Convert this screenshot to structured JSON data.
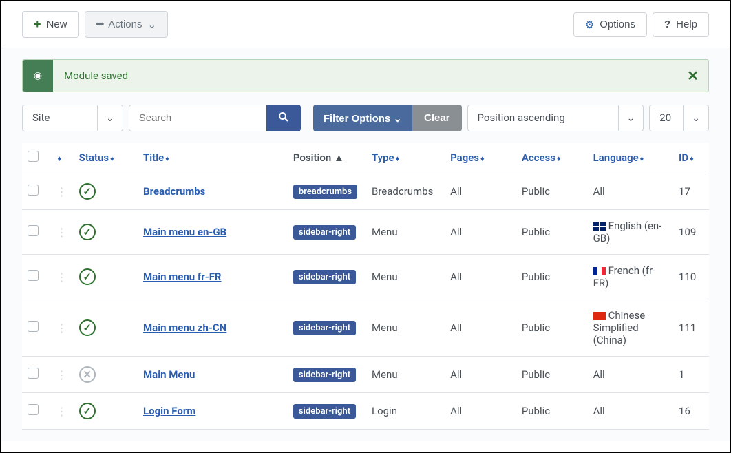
{
  "toolbar": {
    "new_label": "New",
    "actions_label": "Actions",
    "options_label": "Options",
    "help_label": "Help"
  },
  "alert": {
    "message": "Module saved"
  },
  "filters": {
    "site_label": "Site",
    "search_placeholder": "Search",
    "filter_options_label": "Filter Options",
    "clear_label": "Clear",
    "sort_label": "Position ascending",
    "limit_label": "20"
  },
  "columns": {
    "status": "Status",
    "title": "Title",
    "position": "Position",
    "type": "Type",
    "pages": "Pages",
    "access": "Access",
    "language": "Language",
    "id": "ID"
  },
  "rows": [
    {
      "status": "published",
      "title": "Breadcrumbs",
      "position": "breadcrumbs",
      "type": "Breadcrumbs",
      "pages": "All",
      "access": "Public",
      "language": "All",
      "flag": "",
      "id": "17"
    },
    {
      "status": "published",
      "title": "Main menu en-GB",
      "position": "sidebar-right",
      "type": "Menu",
      "pages": "All",
      "access": "Public",
      "language": "English (en-GB)",
      "flag": "gb",
      "id": "109"
    },
    {
      "status": "published",
      "title": "Main menu fr-FR",
      "position": "sidebar-right",
      "type": "Menu",
      "pages": "All",
      "access": "Public",
      "language": "French (fr-FR)",
      "flag": "fr",
      "id": "110"
    },
    {
      "status": "published",
      "title": "Main menu zh-CN",
      "position": "sidebar-right",
      "type": "Menu",
      "pages": "All",
      "access": "Public",
      "language": "Chinese Simplified (China)",
      "flag": "cn",
      "id": "111"
    },
    {
      "status": "unpublished",
      "title": "Main Menu",
      "position": "sidebar-right",
      "type": "Menu",
      "pages": "All",
      "access": "Public",
      "language": "All",
      "flag": "",
      "id": "1"
    },
    {
      "status": "published",
      "title": "Login Form",
      "position": "sidebar-right",
      "type": "Login",
      "pages": "All",
      "access": "Public",
      "language": "All",
      "flag": "",
      "id": "16"
    }
  ]
}
